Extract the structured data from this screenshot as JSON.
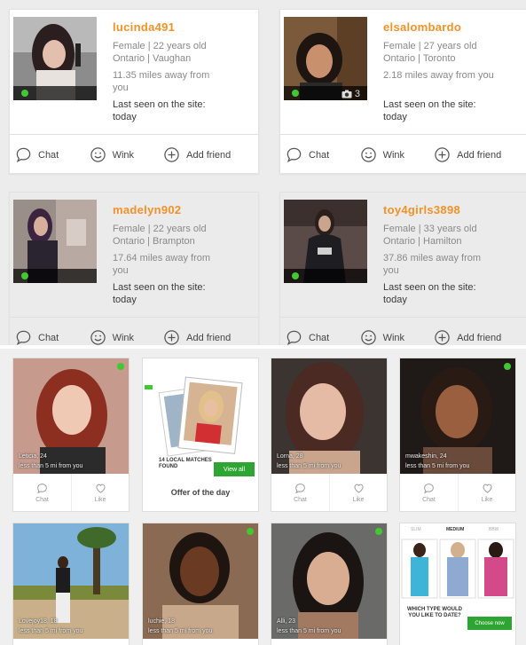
{
  "profiles": [
    {
      "username": "lucinda491",
      "gender_age": "Female | 22 years old",
      "location": "Ontario | Vaughan",
      "distance": "11.35 miles away from you",
      "seen_label": "Last seen on the site:",
      "seen_value": "today",
      "photo_count": ""
    },
    {
      "username": "elsalombardo",
      "gender_age": "Female | 27 years old",
      "location": "Ontario | Toronto",
      "distance": "2.18 miles away from you",
      "seen_label": "Last seen on the site:",
      "seen_value": "today",
      "photo_count": "3"
    },
    {
      "username": "madelyn902",
      "gender_age": "Female | 22 years old",
      "location": "Ontario | Brampton",
      "distance": "17.64 miles away from you",
      "seen_label": "Last seen on the site:",
      "seen_value": "today",
      "photo_count": ""
    },
    {
      "username": "toy4girls3898",
      "gender_age": "Female | 33 years old",
      "location": "Ontario | Hamilton",
      "distance": "37.86 miles away from you",
      "seen_label": "Last seen on the site:",
      "seen_value": "today",
      "photo_count": ""
    }
  ],
  "card_actions": {
    "chat": "Chat",
    "wink": "Wink",
    "add_friend": "Add friend"
  },
  "tiles": [
    {
      "name": "Leticia, 24",
      "distance": "less than 5 mi from you"
    },
    {
      "name": "Lorna, 28",
      "distance": "less than 5 mi from you"
    },
    {
      "name": "mwakeshin, 24",
      "distance": "less than 5 mi from you"
    },
    {
      "name": "Lovejoy18, 18",
      "distance": "less than 5 mi from you"
    },
    {
      "name": "luchie, 18",
      "distance": "less than 5 mi from you"
    },
    {
      "name": "Alli, 23",
      "distance": "less than 5 mi from you"
    }
  ],
  "tile_actions": {
    "chat": "Chat",
    "like": "Like"
  },
  "offer": {
    "matches": "14 LOCAL MATCHES FOUND",
    "view_all": "View all",
    "title": "Offer of the day"
  },
  "type_tile": {
    "tabs": [
      "SLIM",
      "MEDIUM",
      "BBW"
    ],
    "question": "WHICH TYPE WOULD YOU LIKE TO DATE?",
    "button": "Choose now"
  },
  "colors": {
    "username": "#f0922a",
    "online": "#41c832",
    "button_green": "#2ea532"
  }
}
